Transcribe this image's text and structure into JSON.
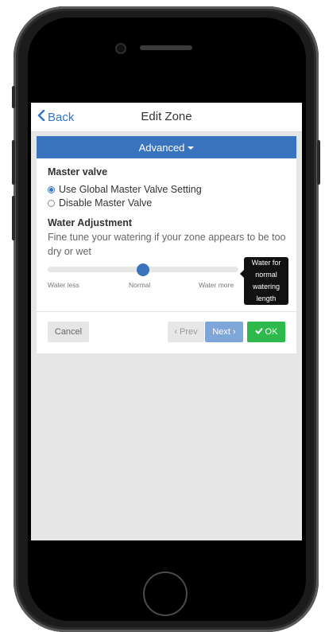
{
  "nav": {
    "back_label": "Back",
    "title": "Edit Zone"
  },
  "panel": {
    "header_label": "Advanced",
    "master_valve": {
      "title": "Master valve",
      "options": [
        {
          "label": "Use Global Master Valve Setting",
          "selected": true
        },
        {
          "label": "Disable Master Valve",
          "selected": false
        }
      ]
    },
    "water_adjustment": {
      "title": "Water Adjustment",
      "description": "Fine tune your watering if your zone appears to be too dry or wet",
      "slider_value": 0.5,
      "tick_labels": [
        "Water less",
        "Normal",
        "Water more"
      ],
      "tooltip": [
        "Water for",
        "normal",
        "watering",
        "length"
      ]
    }
  },
  "buttons": {
    "cancel": "Cancel",
    "prev": "‹ Prev",
    "next": "Next ›",
    "ok": "OK"
  },
  "colors": {
    "accent": "#3a74bf",
    "ok": "#2fb84c",
    "next": "#7fa6d8"
  }
}
